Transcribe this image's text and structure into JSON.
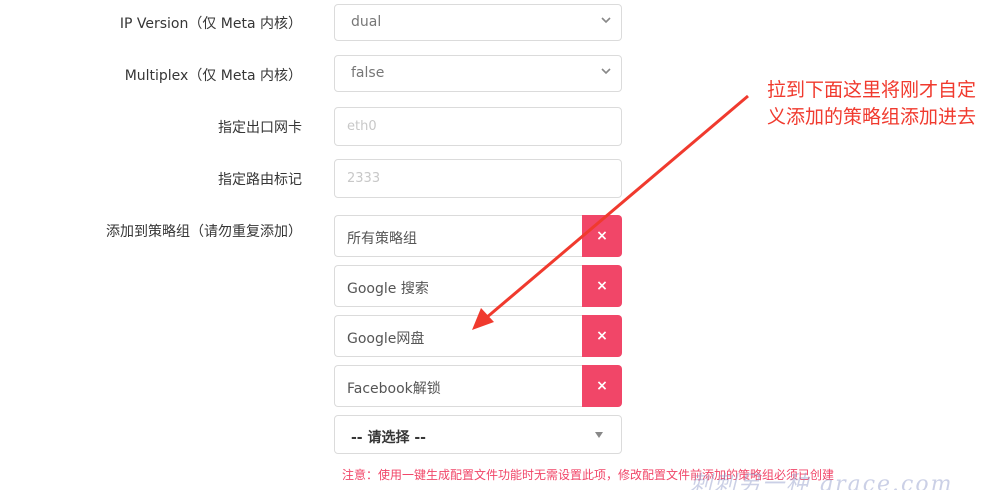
{
  "fields": [
    {
      "label": "IP Version（仅 Meta 内核）",
      "value": "dual"
    },
    {
      "label": "Multiplex（仅 Meta 内核）",
      "value": "false"
    }
  ],
  "inputs": [
    {
      "label": "指定出口网卡",
      "placeholder": "eth0"
    },
    {
      "label": "指定路由标记",
      "placeholder": "2333"
    }
  ],
  "policy": {
    "label": "添加到策略组（请勿重复添加）",
    "groups": [
      "所有策略组",
      "Google 搜索",
      "Google网盘",
      "Facebook解锁"
    ],
    "remove_symbol": "×",
    "choose_placeholder": "-- 请选择 --",
    "notice": "注意：使用一键生成配置文件功能时无需设置此项，修改配置文件前添加的策略组必须已创建"
  },
  "annotation": {
    "text": "拉到下面这里将刚才自定义添加的策略组添加进去",
    "color": "#f03a2e"
  },
  "watermark": "刺刺另一种 grace.com",
  "colors": {
    "danger": "#f14668",
    "border": "#dbdbdb"
  }
}
